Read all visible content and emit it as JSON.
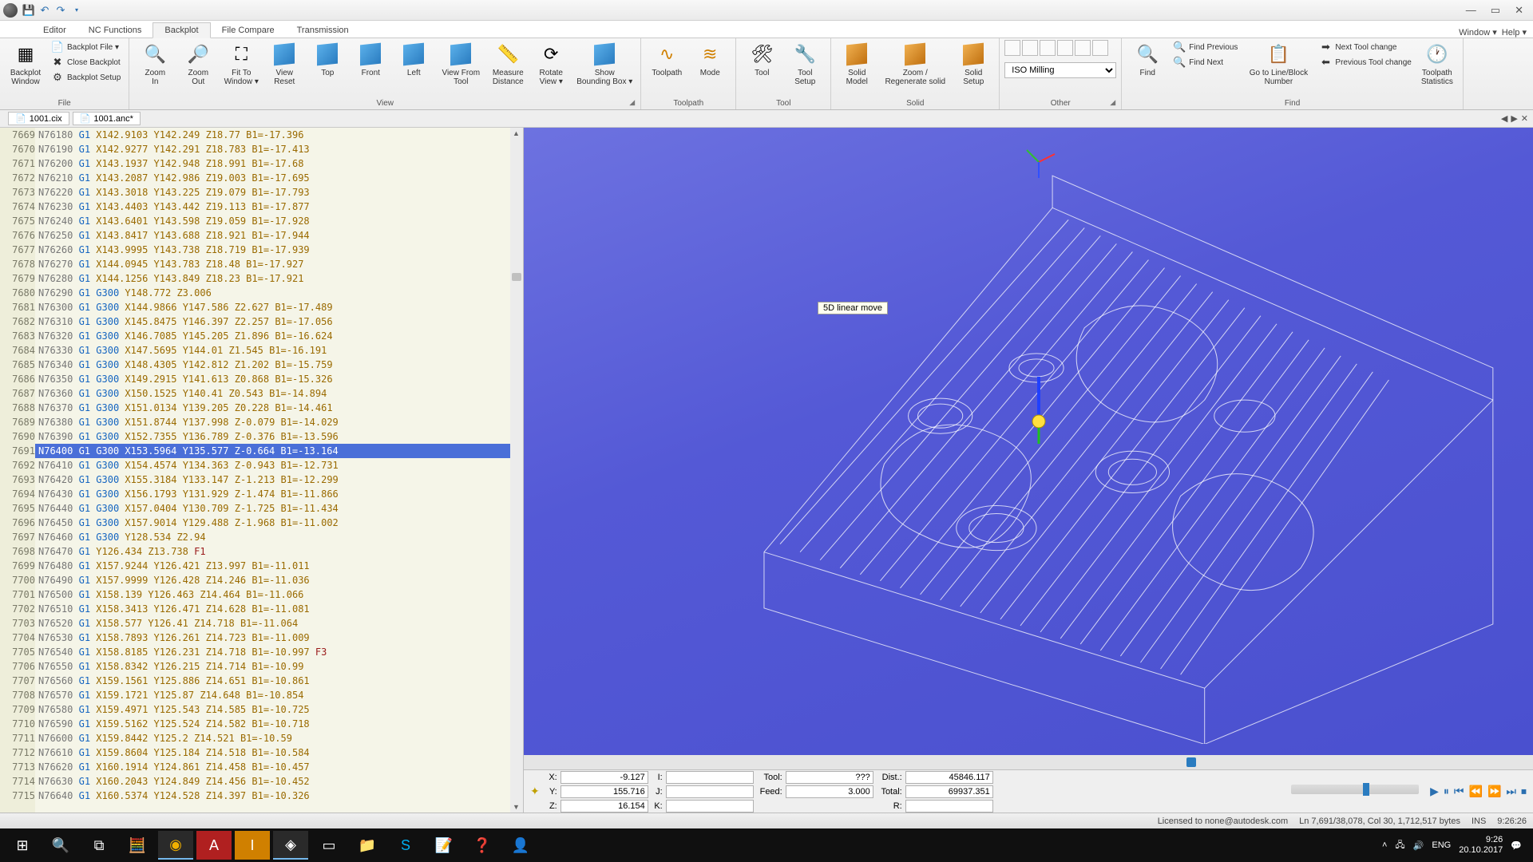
{
  "window": {
    "title": ""
  },
  "menu_right": {
    "window": "Window ▾",
    "help": "Help ▾"
  },
  "tabs": {
    "editor": "Editor",
    "nc": "NC Functions",
    "backplot": "Backplot",
    "compare": "File Compare",
    "transmission": "Transmission"
  },
  "ribbon": {
    "file": {
      "label": "File",
      "backplot_window": "Backplot\nWindow",
      "backplot_file": "Backplot File ▾",
      "close_backplot": "Close Backplot",
      "backplot_setup": "Backplot Setup"
    },
    "view": {
      "label": "View",
      "zoom_in": "Zoom\nIn",
      "zoom_out": "Zoom\nOut",
      "fit": "Fit To\nWindow ▾",
      "view_reset": "View\nReset",
      "top": "Top",
      "front": "Front",
      "left": "Left",
      "view_from": "View From\nTool",
      "measure": "Measure\nDistance",
      "rotate": "Rotate\nView ▾",
      "show_bb": "Show\nBounding Box ▾"
    },
    "toolpath": {
      "label": "Toolpath",
      "toolpath": "Toolpath",
      "mode": "Mode"
    },
    "tool": {
      "label": "Tool",
      "tool": "Tool",
      "setup": "Tool\nSetup"
    },
    "solid": {
      "label": "Solid",
      "model": "Solid\nModel",
      "regen": "Zoom /\nRegenerate solid",
      "setup": "Solid\nSetup"
    },
    "other": {
      "label": "Other",
      "iso": "ISO Milling"
    },
    "find": {
      "label": "Find",
      "find": "Find",
      "prev": "Find Previous",
      "next": "Find Next",
      "goto": "Go to Line/Block\nNumber",
      "next_tc": "Next Tool change",
      "prev_tc": "Previous Tool change",
      "stats": "Toolpath\nStatistics"
    }
  },
  "doctabs": {
    "a": "1001.cix",
    "b": "1001.anc*"
  },
  "code_lines": [
    {
      "num": 7669,
      "txt": "N76180 G1 X142.9103 Y142.249 Z18.77 B1=-17.396"
    },
    {
      "num": 7670,
      "txt": "N76190 G1 X142.9277 Y142.291 Z18.783 B1=-17.413"
    },
    {
      "num": 7671,
      "txt": "N76200 G1 X143.1937 Y142.948 Z18.991 B1=-17.68"
    },
    {
      "num": 7672,
      "txt": "N76210 G1 X143.2087 Y142.986 Z19.003 B1=-17.695"
    },
    {
      "num": 7673,
      "txt": "N76220 G1 X143.3018 Y143.225 Z19.079 B1=-17.793"
    },
    {
      "num": 7674,
      "txt": "N76230 G1 X143.4403 Y143.442 Z19.113 B1=-17.877"
    },
    {
      "num": 7675,
      "txt": "N76240 G1 X143.6401 Y143.598 Z19.059 B1=-17.928"
    },
    {
      "num": 7676,
      "txt": "N76250 G1 X143.8417 Y143.688 Z18.921 B1=-17.944"
    },
    {
      "num": 7677,
      "txt": "N76260 G1 X143.9995 Y143.738 Z18.719 B1=-17.939"
    },
    {
      "num": 7678,
      "txt": "N76270 G1 X144.0945 Y143.783 Z18.48 B1=-17.927"
    },
    {
      "num": 7679,
      "txt": "N76280 G1 X144.1256 Y143.849 Z18.23 B1=-17.921"
    },
    {
      "num": 7680,
      "txt": "N76290 G1 G300 Y148.772 Z3.006"
    },
    {
      "num": 7681,
      "txt": "N76300 G1 G300 X144.9866 Y147.586 Z2.627 B1=-17.489"
    },
    {
      "num": 7682,
      "txt": "N76310 G1 G300 X145.8475 Y146.397 Z2.257 B1=-17.056"
    },
    {
      "num": 7683,
      "txt": "N76320 G1 G300 X146.7085 Y145.205 Z1.896 B1=-16.624"
    },
    {
      "num": 7684,
      "txt": "N76330 G1 G300 X147.5695 Y144.01 Z1.545 B1=-16.191"
    },
    {
      "num": 7685,
      "txt": "N76340 G1 G300 X148.4305 Y142.812 Z1.202 B1=-15.759"
    },
    {
      "num": 7686,
      "txt": "N76350 G1 G300 X149.2915 Y141.613 Z0.868 B1=-15.326"
    },
    {
      "num": 7687,
      "txt": "N76360 G1 G300 X150.1525 Y140.41 Z0.543 B1=-14.894"
    },
    {
      "num": 7688,
      "txt": "N76370 G1 G300 X151.0134 Y139.205 Z0.228 B1=-14.461"
    },
    {
      "num": 7689,
      "txt": "N76380 G1 G300 X151.8744 Y137.998 Z-0.079 B1=-14.029"
    },
    {
      "num": 7690,
      "txt": "N76390 G1 G300 X152.7355 Y136.789 Z-0.376 B1=-13.596"
    },
    {
      "num": 7691,
      "txt": "N76400 G1 G300 X153.5964 Y135.577 Z-0.664 B1=-13.164",
      "hl": true
    },
    {
      "num": 7692,
      "txt": "N76410 G1 G300 X154.4574 Y134.363 Z-0.943 B1=-12.731"
    },
    {
      "num": 7693,
      "txt": "N76420 G1 G300 X155.3184 Y133.147 Z-1.213 B1=-12.299"
    },
    {
      "num": 7694,
      "txt": "N76430 G1 G300 X156.1793 Y131.929 Z-1.474 B1=-11.866"
    },
    {
      "num": 7695,
      "txt": "N76440 G1 G300 X157.0404 Y130.709 Z-1.725 B1=-11.434"
    },
    {
      "num": 7696,
      "txt": "N76450 G1 G300 X157.9014 Y129.488 Z-1.968 B1=-11.002"
    },
    {
      "num": 7697,
      "txt": "N76460 G1 G300 Y128.534 Z2.94"
    },
    {
      "num": 7698,
      "txt": "N76470 G1 Y126.434 Z13.738 F1"
    },
    {
      "num": 7699,
      "txt": "N76480 G1 X157.9244 Y126.421 Z13.997 B1=-11.011"
    },
    {
      "num": 7700,
      "txt": "N76490 G1 X157.9999 Y126.428 Z14.246 B1=-11.036"
    },
    {
      "num": 7701,
      "txt": "N76500 G1 X158.139 Y126.463 Z14.464 B1=-11.066"
    },
    {
      "num": 7702,
      "txt": "N76510 G1 X158.3413 Y126.471 Z14.628 B1=-11.081"
    },
    {
      "num": 7703,
      "txt": "N76520 G1 X158.577 Y126.41 Z14.718 B1=-11.064"
    },
    {
      "num": 7704,
      "txt": "N76530 G1 X158.7893 Y126.261 Z14.723 B1=-11.009"
    },
    {
      "num": 7705,
      "txt": "N76540 G1 X158.8185 Y126.231 Z14.718 B1=-10.997 F3"
    },
    {
      "num": 7706,
      "txt": "N76550 G1 X158.8342 Y126.215 Z14.714 B1=-10.99"
    },
    {
      "num": 7707,
      "txt": "N76560 G1 X159.1561 Y125.886 Z14.651 B1=-10.861"
    },
    {
      "num": 7708,
      "txt": "N76570 G1 X159.1721 Y125.87 Z14.648 B1=-10.854"
    },
    {
      "num": 7709,
      "txt": "N76580 G1 X159.4971 Y125.543 Z14.585 B1=-10.725"
    },
    {
      "num": 7710,
      "txt": "N76590 G1 X159.5162 Y125.524 Z14.582 B1=-10.718"
    },
    {
      "num": 7711,
      "txt": "N76600 G1 X159.8442 Y125.2 Z14.521 B1=-10.59"
    },
    {
      "num": 7712,
      "txt": "N76610 G1 X159.8604 Y125.184 Z14.518 B1=-10.584"
    },
    {
      "num": 7713,
      "txt": "N76620 G1 X160.1914 Y124.861 Z14.458 B1=-10.457"
    },
    {
      "num": 7714,
      "txt": "N76630 G1 X160.2043 Y124.849 Z14.456 B1=-10.452"
    },
    {
      "num": 7715,
      "txt": "N76640 G1 X160.5374 Y124.528 Z14.397 B1=-10.326"
    }
  ],
  "viewport": {
    "tooltip": "5D linear move"
  },
  "readout": {
    "X": "-9.127",
    "Y": "155.716",
    "Z": "16.154",
    "I": "",
    "J": "",
    "K": "",
    "Tool": "???",
    "Feed": "3.000",
    "blank": "",
    "Dist": "45846.117",
    "Total": "69937.351",
    "R": ""
  },
  "status": {
    "license": "Licensed to none@autodesk.com",
    "pos": "Ln 7,691/38,078, Col 30, 1,712,517 bytes",
    "ins": "INS",
    "time": "9:26:26"
  },
  "tray": {
    "lang": "ENG",
    "time": "9:26",
    "date": "20.10.2017"
  }
}
